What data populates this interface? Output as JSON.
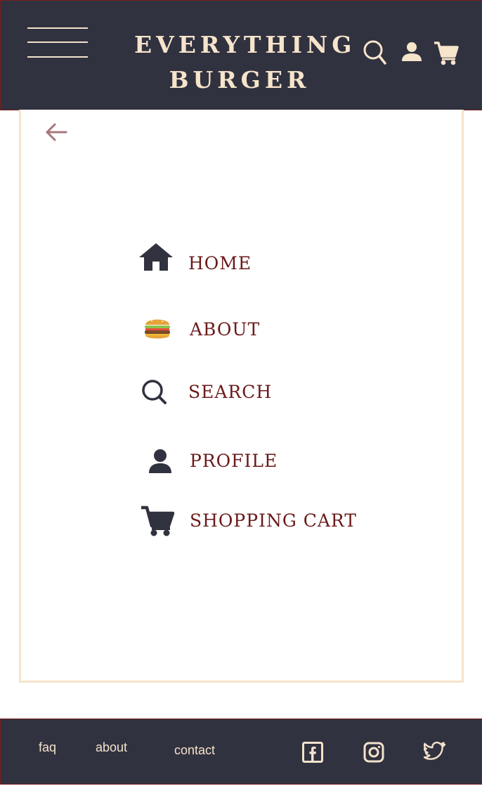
{
  "header": {
    "brand_line1": "EVERYTHING",
    "brand_line2": "BURGER",
    "icons": [
      "hamburger-menu-icon",
      "search-icon",
      "user-icon",
      "cart-icon"
    ]
  },
  "nav": {
    "back_icon": "arrow-left-icon",
    "items": [
      {
        "label": "HOME",
        "icon": "home-icon"
      },
      {
        "label": "ABOUT",
        "icon": "burger-icon"
      },
      {
        "label": "SEARCH",
        "icon": "search-icon"
      },
      {
        "label": "PROFILE",
        "icon": "user-icon"
      },
      {
        "label": "SHOPPING CART",
        "icon": "cart-icon"
      }
    ]
  },
  "footer": {
    "links": [
      "faq",
      "about",
      "contact"
    ],
    "social_icons": [
      "facebook-icon",
      "instagram-icon",
      "twitter-icon"
    ]
  },
  "colors": {
    "header_bg": "#31323f",
    "header_text": "#f6e4cb",
    "menu_text": "#6b1a1a",
    "menu_icon": "#31323f",
    "panel_border": "#f6e3cc",
    "back_arrow": "#a5777a"
  }
}
